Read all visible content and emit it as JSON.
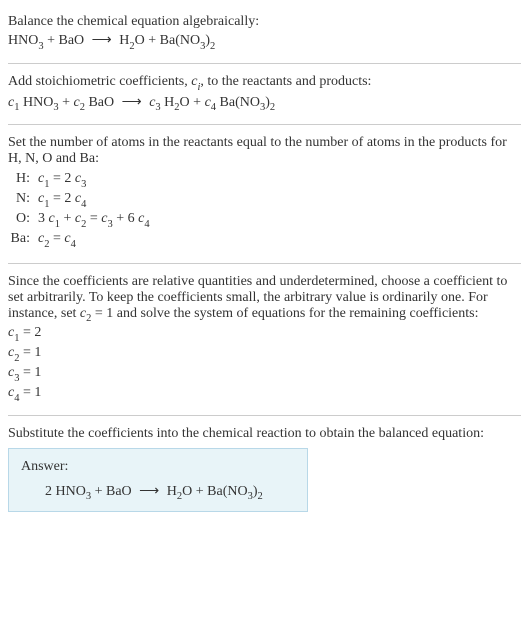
{
  "intro": {
    "line1": "Balance the chemical equation algebraically:",
    "reactant1": "HNO",
    "reactant1_sub": "3",
    "reactant2": "BaO",
    "product1": "H",
    "product1_sub": "2",
    "product1_b": "O",
    "product2": "Ba(NO",
    "product2_sub": "3",
    "product2_b": ")",
    "product2_sub2": "2"
  },
  "stoich": {
    "line1_a": "Add stoichiometric coefficients, ",
    "line1_ci": "c",
    "line1_ci_sub": "i",
    "line1_b": ", to the reactants and products:",
    "c1": "c",
    "c1_sub": "1",
    "c2": "c",
    "c2_sub": "2",
    "c3": "c",
    "c3_sub": "3",
    "c4": "c",
    "c4_sub": "4"
  },
  "atoms": {
    "intro": "Set the number of atoms in the reactants equal to the number of atoms in the products for H, N, O and Ba:",
    "rows": [
      {
        "label": "H:",
        "eq_a": "c",
        "eq_a_sub": "1",
        "eq_mid": " = 2 ",
        "eq_b": "c",
        "eq_b_sub": "3"
      },
      {
        "label": "N:",
        "eq_a": "c",
        "eq_a_sub": "1",
        "eq_mid": " = 2 ",
        "eq_b": "c",
        "eq_b_sub": "4"
      }
    ],
    "o_row": {
      "label": "O:",
      "p1": "3 ",
      "c1": "c",
      "c1_sub": "1",
      "p2": " + ",
      "c2": "c",
      "c2_sub": "2",
      "p3": " = ",
      "c3": "c",
      "c3_sub": "3",
      "p4": " + 6 ",
      "c4": "c",
      "c4_sub": "4"
    },
    "ba_row": {
      "label": "Ba:",
      "c2": "c",
      "c2_sub": "2",
      "eq": " = ",
      "c4": "c",
      "c4_sub": "4"
    }
  },
  "solve": {
    "intro_a": "Since the coefficients are relative quantities and underdetermined, choose a coefficient to set arbitrarily. To keep the coefficients small, the arbitrary value is ordinarily one. For instance, set ",
    "intro_c": "c",
    "intro_c_sub": "2",
    "intro_b": " = 1 and solve the system of equations for the remaining coefficients:",
    "lines": [
      {
        "c": "c",
        "sub": "1",
        "val": " = 2"
      },
      {
        "c": "c",
        "sub": "2",
        "val": " = 1"
      },
      {
        "c": "c",
        "sub": "3",
        "val": " = 1"
      },
      {
        "c": "c",
        "sub": "4",
        "val": " = 1"
      }
    ]
  },
  "final": {
    "intro": "Substitute the coefficients into the chemical reaction to obtain the balanced equation:",
    "answer_label": "Answer:",
    "coef": "2 "
  },
  "arrow": "⟶",
  "plus": " + "
}
